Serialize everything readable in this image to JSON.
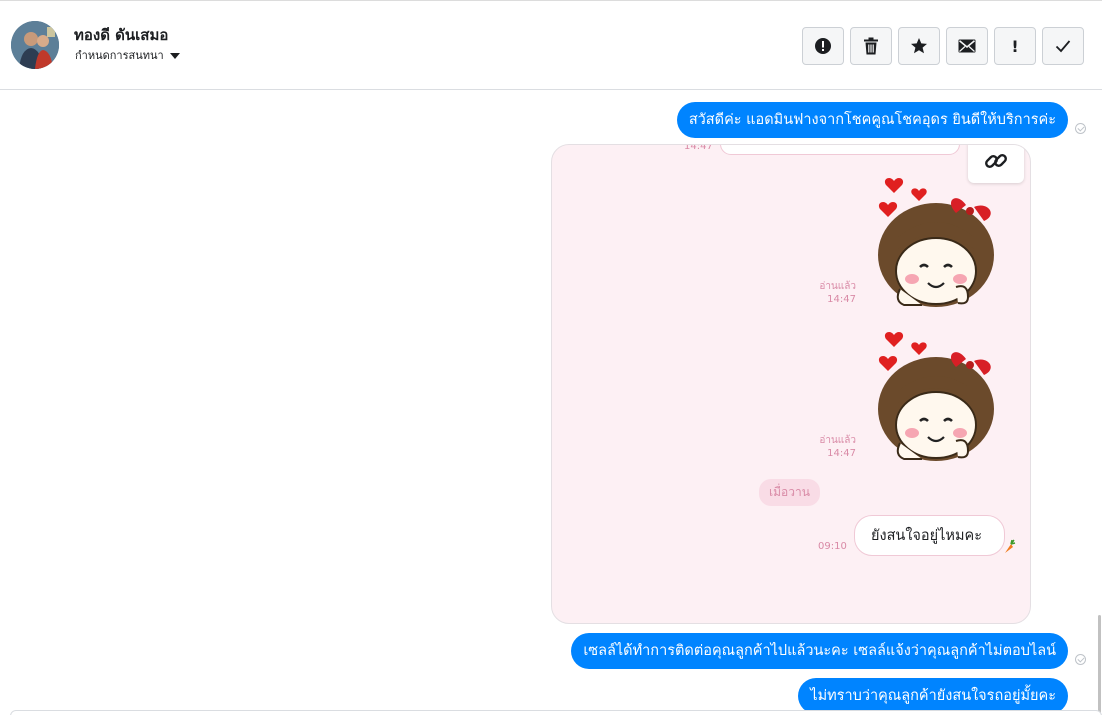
{
  "header": {
    "contact_name": "ทองดี ดันเสมอ",
    "conversation_setting": "กำหนดการสนทนา"
  },
  "toolbar": {
    "buttons": [
      {
        "icon": "alert-circle-icon"
      },
      {
        "icon": "trash-icon"
      },
      {
        "icon": "star-icon"
      },
      {
        "icon": "envelope-icon"
      },
      {
        "icon": "exclamation-icon",
        "glyph": "!"
      },
      {
        "icon": "check-icon"
      }
    ]
  },
  "messages": [
    {
      "text": "สวัสดีค่ะ แอดมินฟางจากโชคคูณโชคอุดร ยินดีให้บริการค่ะ",
      "status": "seen"
    },
    {
      "text": "เซลล์ได้ทำการติดต่อคุณลูกค้าไปแล้วนะคะ  เซลล์แจ้งว่าคุณลูกค้าไม่ตอบไลน์",
      "status": "seen"
    },
    {
      "text": "ไม่ทราบว่าคุณลูกค้ายังสนใจรถอยู่มั้ยคะ",
      "status": "sent"
    }
  ],
  "screenshot": {
    "top_time": "14:47",
    "sticker_meta": [
      {
        "read": "อ่านแล้ว",
        "time": "14:47"
      },
      {
        "read": "อ่านแล้ว",
        "time": "14:47"
      }
    ],
    "date_divider": "เมื่อวาน",
    "bubble_time": "09:10",
    "bubble_text": "ยังสนใจอยู่ไหมคะ"
  },
  "colors": {
    "accent": "#0084ff",
    "pink_bg": "#fdf0f4",
    "pink_text": "#d98aa6"
  }
}
